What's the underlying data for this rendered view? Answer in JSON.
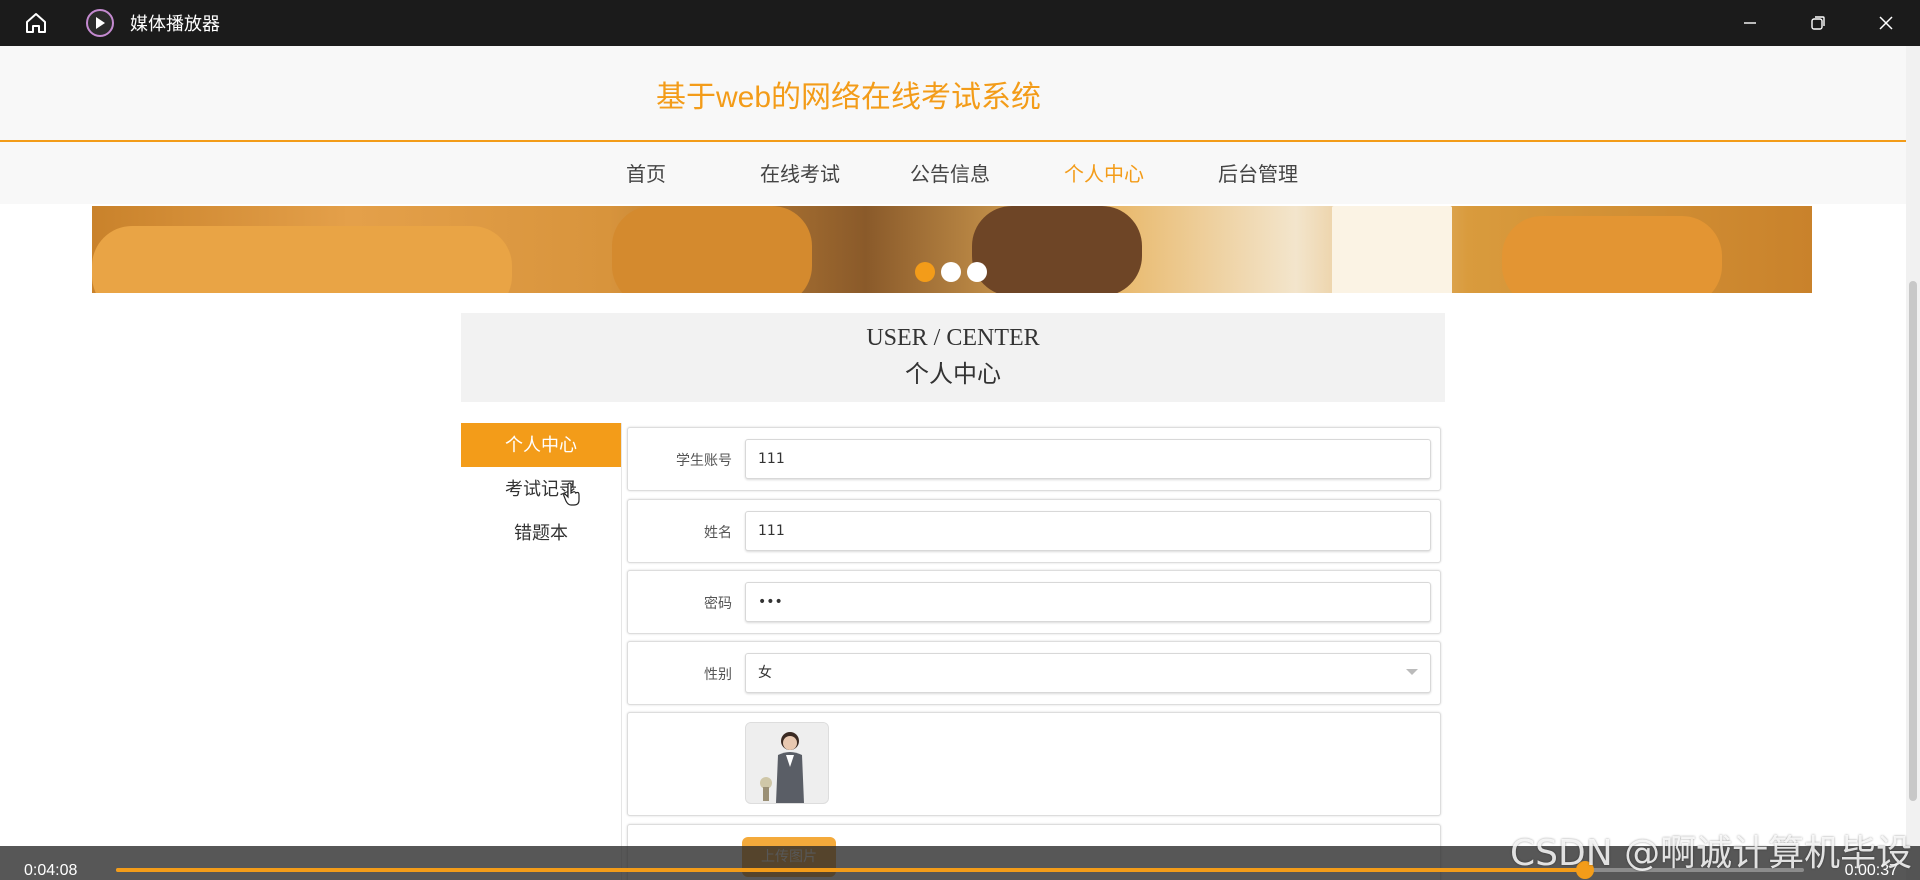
{
  "window": {
    "app_title": "媒体播放器",
    "home_icon": "home-icon",
    "app_icon": "media-player-icon",
    "controls": [
      "minimize-icon",
      "restore-icon",
      "close-icon"
    ]
  },
  "site": {
    "title": "基于web的网络在线考试系统",
    "accent_color": "#f39c19",
    "nav": [
      {
        "label": "首页",
        "active": false
      },
      {
        "label": "在线考试",
        "active": false
      },
      {
        "label": "公告信息",
        "active": false
      },
      {
        "label": "个人中心",
        "active": true
      },
      {
        "label": "后台管理",
        "active": false
      }
    ]
  },
  "banner": {
    "dots": 3,
    "active_dot": 0
  },
  "user_center": {
    "title_en": "USER / CENTER",
    "title_cn": "个人中心"
  },
  "sidebar": {
    "items": [
      {
        "label": "个人中心",
        "active": true
      },
      {
        "label": "考试记录",
        "active": false
      },
      {
        "label": "错题本",
        "active": false
      }
    ]
  },
  "form": {
    "fields": [
      {
        "label": "学生账号",
        "value": "111"
      },
      {
        "label": "姓名",
        "value": "111"
      },
      {
        "label": "密码",
        "value": "•••"
      },
      {
        "label": "性别",
        "value": "女"
      }
    ],
    "upload_label": "上传图片"
  },
  "player": {
    "elapsed": "0:04:08",
    "remaining": "0:00:37",
    "progress_fraction": 0.87
  },
  "watermark": "CSDN @啊诚计算机毕设"
}
